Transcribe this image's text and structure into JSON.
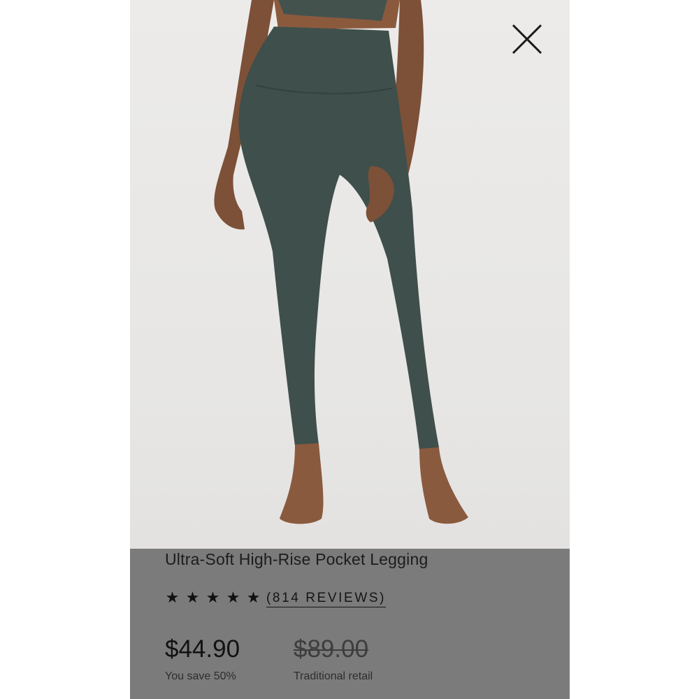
{
  "colors": {
    "photo_background": "#e9e8e6",
    "legging": "#3f4f4b",
    "skin": "#8a5a3f",
    "panel_overlay": "#7b7b7b",
    "text": "#1c1c1c"
  },
  "product_image": {
    "icon": "legging-photo"
  },
  "close_button": {
    "icon": "close-icon"
  },
  "product": {
    "title": "Ultra-Soft High-Rise Pocket Legging",
    "rating": {
      "stars": 5,
      "max": 5,
      "reviews_label": "(814 REVIEWS)"
    },
    "price": "$44.90",
    "savings": "You save 50%",
    "original_price": "$89.00",
    "original_label": "Traditional retail"
  }
}
